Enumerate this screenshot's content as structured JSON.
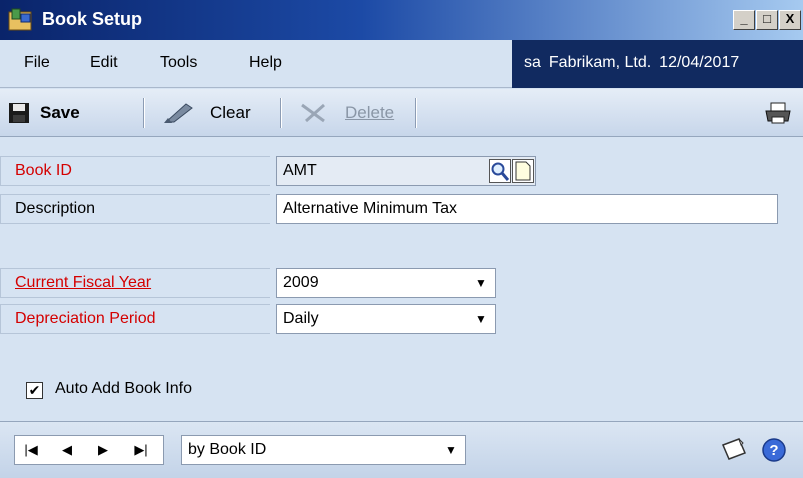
{
  "window": {
    "title": "Book Setup",
    "controls": {
      "minimize": "_",
      "maximize": "□",
      "close": "X"
    }
  },
  "menu": {
    "items": [
      "File",
      "Edit",
      "Tools",
      "Help"
    ],
    "user": "sa",
    "company": "Fabrikam, Ltd.",
    "date": "12/04/2017"
  },
  "toolbar": {
    "save_label": "Save",
    "clear_label": "Clear",
    "delete_label": "Delete",
    "icons": [
      "save-icon",
      "clear-icon",
      "delete-icon",
      "print-icon"
    ]
  },
  "form": {
    "book_id": {
      "label": "Book ID",
      "value": "AMT"
    },
    "description": {
      "label": "Description",
      "value": "Alternative Minimum Tax"
    },
    "current_fiscal_year": {
      "label": "Current Fiscal Year",
      "value": "2009"
    },
    "depreciation_period": {
      "label": "Depreciation Period",
      "value": "Daily"
    },
    "auto_add": {
      "label": "Auto Add Book Info",
      "checked": true,
      "mark": "✔"
    }
  },
  "footer": {
    "nav": {
      "first": "|◀",
      "prev": "◀",
      "next": "▶",
      "last": "▶|"
    },
    "sort_by": "by Book ID",
    "icons": [
      "note-icon",
      "help-icon"
    ]
  },
  "colors": {
    "title_gradient_start": "#0a246a",
    "title_gradient_end": "#a6caf0",
    "user_info_bg": "#112a60",
    "required_label": "#d40000",
    "window_bg": "#d6e3f2"
  }
}
